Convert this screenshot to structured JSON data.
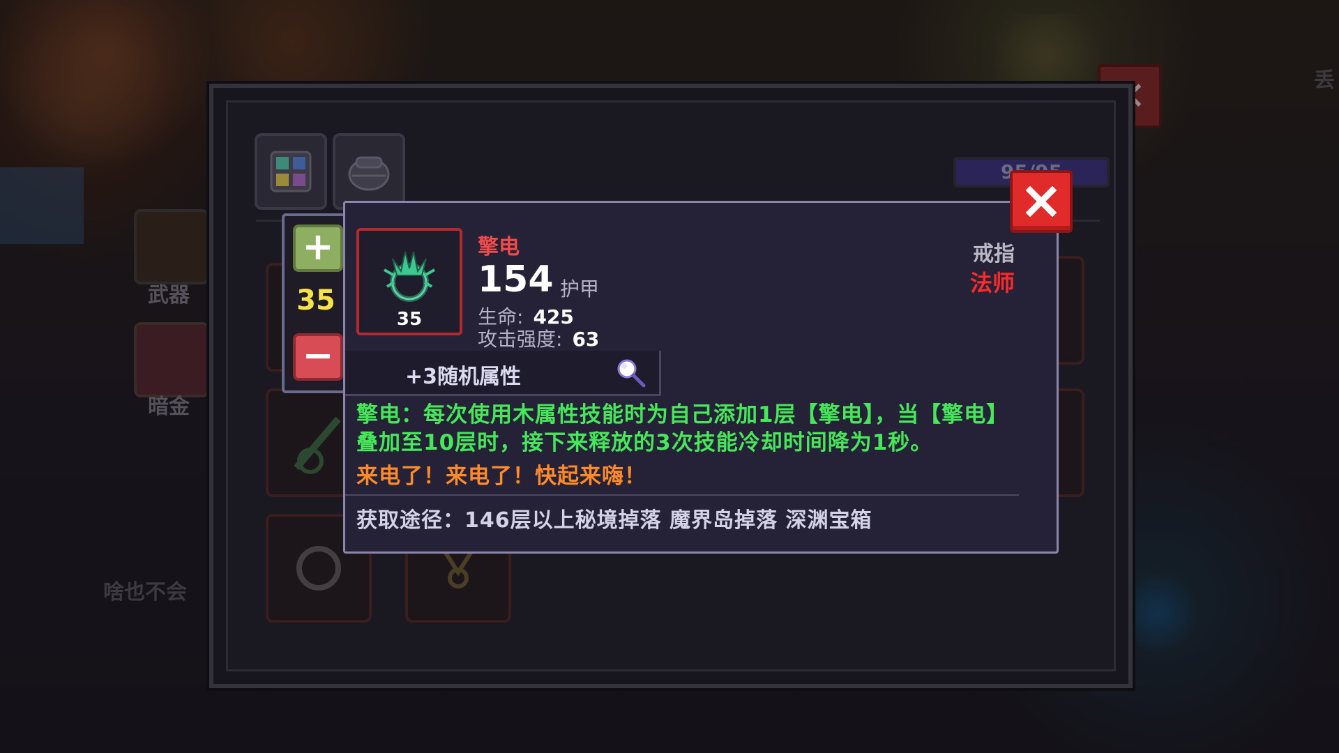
{
  "background": {
    "side_labels": [
      "武器",
      "暗金"
    ],
    "bottom_text": "啥也不会",
    "corner_text": "丢"
  },
  "inventory": {
    "capacity": "95/95"
  },
  "stepper": {
    "value": "35",
    "plus_label": "+",
    "minus_label": "−"
  },
  "item": {
    "name": "擎电",
    "level": "35",
    "main_stat_value": "154",
    "main_stat_label": "护甲",
    "sub_stats": [
      {
        "label": "生命:",
        "value": "425"
      },
      {
        "label": "攻击强度:",
        "value": "63"
      }
    ],
    "type": "戒指",
    "class": "法师",
    "random_attributes": "+3随机属性",
    "effect": "擎电：每次使用木属性技能时为自己添加1层【擎电】，当【擎电】叠加至10层时，接下来释放的3次技能冷却时间降为1秒。",
    "flavor": "来电了！来电了！快起来嗨！",
    "source": "获取途径：146层以上秘境掉落 魔界岛掉落 深渊宝箱"
  },
  "colors": {
    "item_name": "#ee4b4b",
    "effect_text": "#46e85a",
    "flavor_text": "#ff8a2a",
    "class_text": "#ff2b2b",
    "stepper_value": "#f6e24a",
    "close_button": "#e12a2a"
  },
  "icons": [
    "close-icon",
    "plus-icon",
    "minus-icon",
    "ring-icon",
    "magnifier-icon",
    "bag-icon",
    "grid-icon"
  ]
}
